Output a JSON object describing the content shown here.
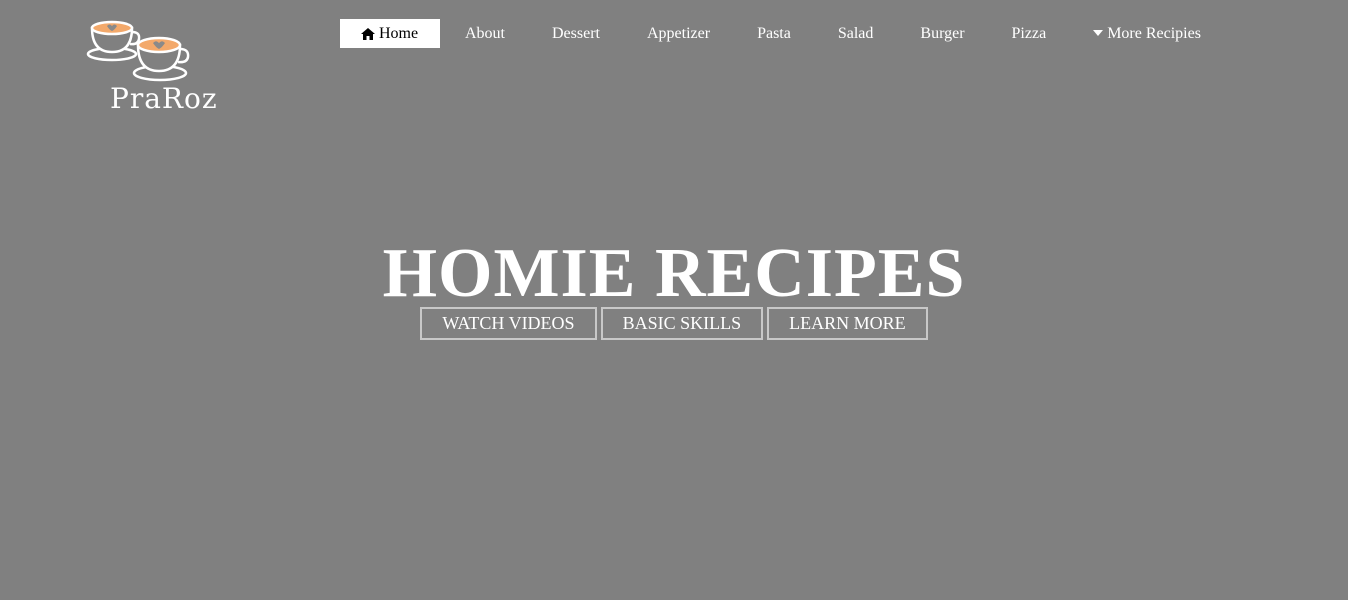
{
  "brand": {
    "name": "PraRoz",
    "logo_icon": "coffee-cups-icon",
    "cup_color": "#ffffff",
    "foam_color": "#f3a96b",
    "heart_color": "#8a8a8a"
  },
  "nav": {
    "items": [
      {
        "label": "Home",
        "icon": "home-icon",
        "active": true
      },
      {
        "label": "About"
      },
      {
        "label": "Dessert"
      },
      {
        "label": "Appetizer"
      },
      {
        "label": "Pasta"
      },
      {
        "label": "Salad"
      },
      {
        "label": "Burger"
      },
      {
        "label": "Pizza"
      },
      {
        "label": "More Recipies",
        "icon": "caret-down-icon"
      }
    ]
  },
  "hero": {
    "title": "HOMIE RECIPES",
    "buttons": [
      {
        "label": "WATCH VIDEOS"
      },
      {
        "label": "BASIC SKILLS"
      },
      {
        "label": "LEARN MORE"
      }
    ]
  },
  "colors": {
    "background": "#808080",
    "text": "#ffffff",
    "active_nav_bg": "#ffffff",
    "button_border": "#c8c8c8"
  }
}
